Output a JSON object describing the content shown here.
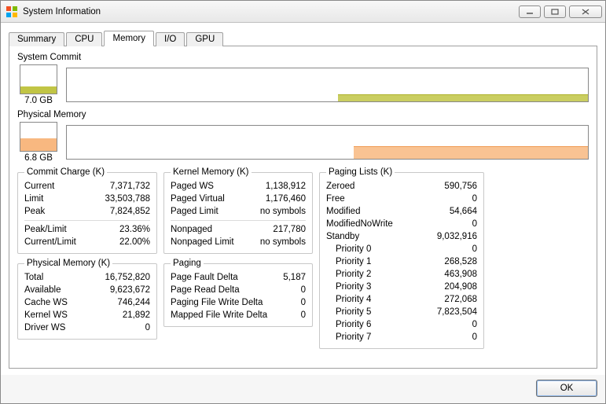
{
  "window": {
    "title": "System Information"
  },
  "tabs": [
    "Summary",
    "CPU",
    "Memory",
    "I/O",
    "GPU"
  ],
  "activeTab": "Memory",
  "graphs": {
    "commit": {
      "title": "System Commit",
      "label": "7.0 GB"
    },
    "phys": {
      "title": "Physical Memory",
      "label": "6.8 GB"
    }
  },
  "commitCharge": {
    "legend": "Commit Charge (K)",
    "current": {
      "k": "Current",
      "v": "7,371,732"
    },
    "limit": {
      "k": "Limit",
      "v": "33,503,788"
    },
    "peak": {
      "k": "Peak",
      "v": "7,824,852"
    },
    "peakLimit": {
      "k": "Peak/Limit",
      "v": "23.36%"
    },
    "curLimit": {
      "k": "Current/Limit",
      "v": "22.00%"
    }
  },
  "physMem": {
    "legend": "Physical Memory (K)",
    "total": {
      "k": "Total",
      "v": "16,752,820"
    },
    "avail": {
      "k": "Available",
      "v": "9,623,672"
    },
    "cache": {
      "k": "Cache WS",
      "v": "746,244"
    },
    "kernel": {
      "k": "Kernel WS",
      "v": "21,892"
    },
    "driver": {
      "k": "Driver WS",
      "v": "0"
    }
  },
  "kernelMem": {
    "legend": "Kernel Memory (K)",
    "pagedws": {
      "k": "Paged WS",
      "v": "1,138,912"
    },
    "pagedv": {
      "k": "Paged Virtual",
      "v": "1,176,460"
    },
    "pagedlim": {
      "k": "Paged Limit",
      "v": "no symbols"
    },
    "nonpaged": {
      "k": "Nonpaged",
      "v": "217,780"
    },
    "nonpagedl": {
      "k": "Nonpaged Limit",
      "v": "no symbols"
    }
  },
  "paging": {
    "legend": "Paging",
    "pfd": {
      "k": "Page Fault Delta",
      "v": "5,187"
    },
    "prd": {
      "k": "Page Read Delta",
      "v": "0"
    },
    "pfwd": {
      "k": "Paging File Write Delta",
      "v": "0"
    },
    "mfwd": {
      "k": "Mapped File Write Delta",
      "v": "0"
    }
  },
  "pagingLists": {
    "legend": "Paging Lists (K)",
    "zeroed": {
      "k": "Zeroed",
      "v": "590,756"
    },
    "free": {
      "k": "Free",
      "v": "0"
    },
    "mod": {
      "k": "Modified",
      "v": "54,664"
    },
    "modnw": {
      "k": "ModifiedNoWrite",
      "v": "0"
    },
    "standby": {
      "k": "Standby",
      "v": "9,032,916"
    },
    "p0": {
      "k": "Priority 0",
      "v": "0"
    },
    "p1": {
      "k": "Priority 1",
      "v": "268,528"
    },
    "p2": {
      "k": "Priority 2",
      "v": "463,908"
    },
    "p3": {
      "k": "Priority 3",
      "v": "204,908"
    },
    "p4": {
      "k": "Priority 4",
      "v": "272,068"
    },
    "p5": {
      "k": "Priority 5",
      "v": "7,823,504"
    },
    "p6": {
      "k": "Priority 6",
      "v": "0"
    },
    "p7": {
      "k": "Priority 7",
      "v": "0"
    }
  },
  "footer": {
    "ok": "OK"
  }
}
